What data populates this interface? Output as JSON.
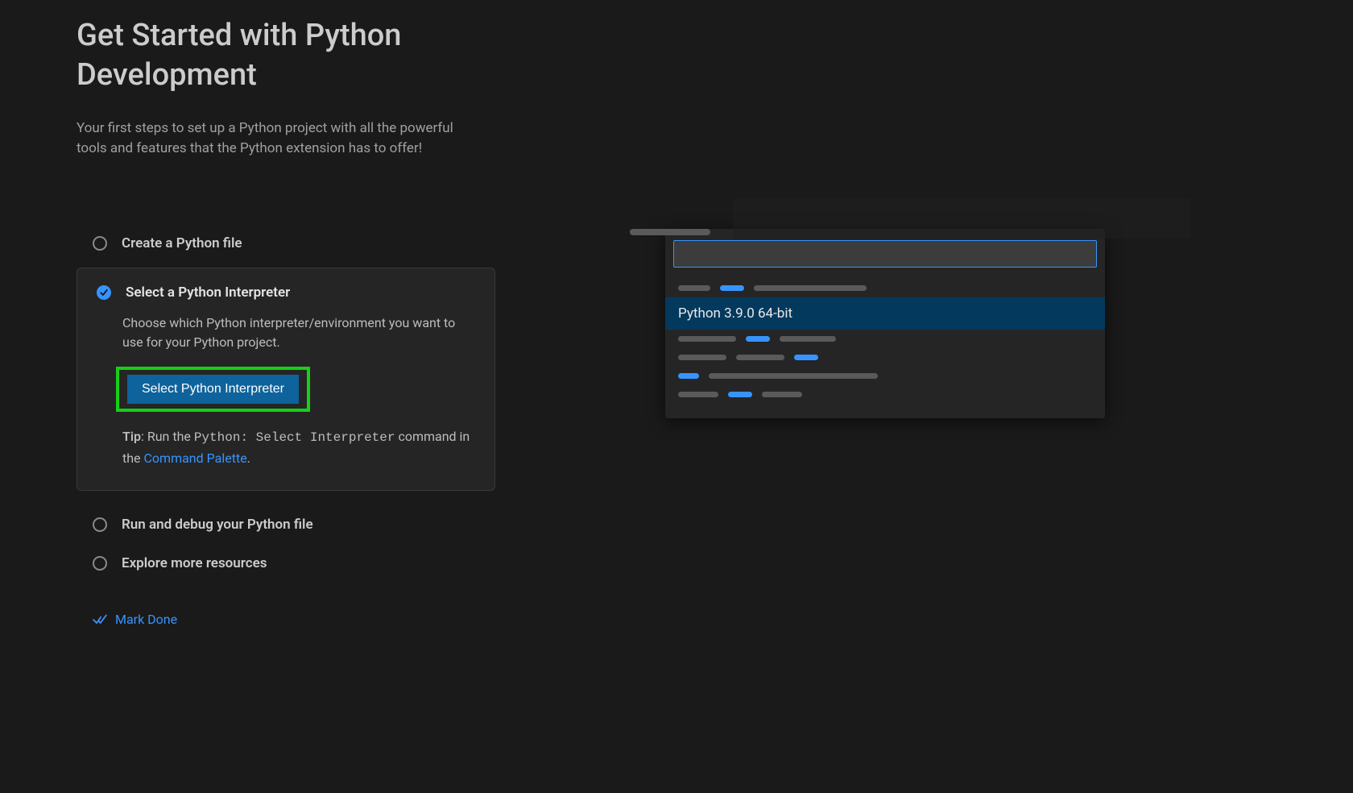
{
  "header": {
    "title": "Get Started with Python Development",
    "subtitle": "Your first steps to set up a Python project with all the powerful tools and features that the Python extension has to offer!"
  },
  "steps": {
    "create_file": {
      "label": "Create a Python file"
    },
    "select_interpreter": {
      "label": "Select a Python Interpreter",
      "description": "Choose which Python interpreter/environment you want to use for your Python project.",
      "button_label": "Select Python Interpreter",
      "tip_prefix": "Tip",
      "tip_text_1": ": Run the ",
      "tip_code": "Python: Select Interpreter",
      "tip_text_2": " command in the ",
      "tip_link": "Command Palette",
      "tip_text_3": "."
    },
    "run_debug": {
      "label": "Run and debug your Python file"
    },
    "explore": {
      "label": "Explore more resources"
    }
  },
  "mark_done": {
    "label": "Mark Done"
  },
  "illustration": {
    "selected_item": "Python 3.9.0 64-bit"
  }
}
